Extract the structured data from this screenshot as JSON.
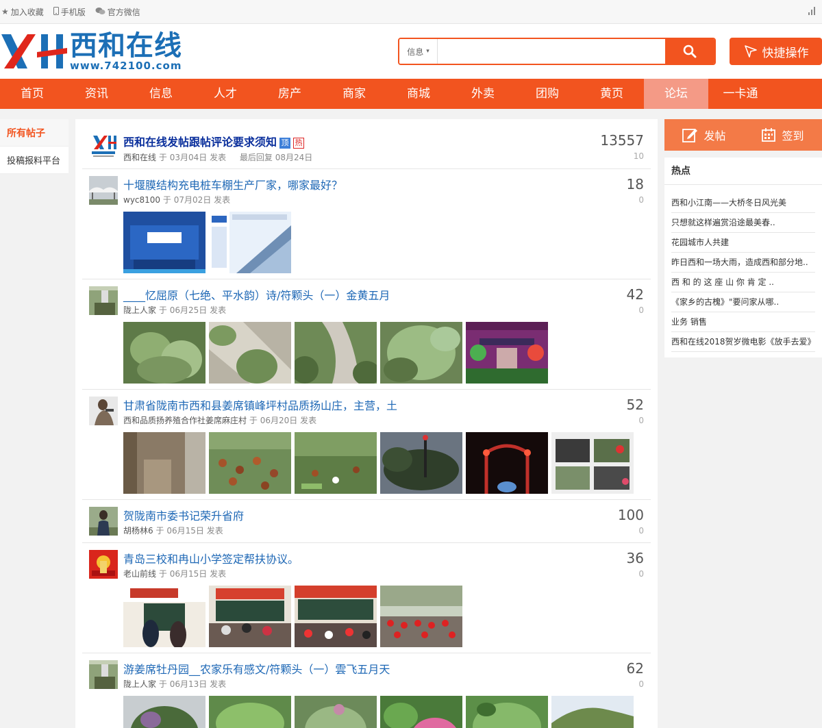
{
  "topbar": {
    "favorite": "加入收藏",
    "mobile": "手机版",
    "wechat": "官方微信"
  },
  "header": {
    "logo_mark": "XH",
    "logo_title": "西和在线",
    "logo_url": "www.742100.com",
    "search_select": "信息",
    "search_placeholder": "",
    "quick_action": "快捷操作"
  },
  "nav": [
    "首页",
    "资讯",
    "信息",
    "人才",
    "房产",
    "商家",
    "商城",
    "外卖",
    "团购",
    "黄页",
    "论坛",
    "一卡通"
  ],
  "nav_active_index": 10,
  "left_sidebar": [
    "所有帖子",
    "投稿报料平台"
  ],
  "posts": [
    {
      "title": "西和在线发帖跟帖评论要求须知",
      "pinned": true,
      "tag_top": "顶",
      "tag_hot": "热",
      "author": "西和在线",
      "yu": "于",
      "date": "03月04日",
      "fabiao": "发表",
      "last_reply_label": "最后回复",
      "last_reply": "08月24日",
      "count": "13557",
      "sub": "10",
      "images": 0
    },
    {
      "title": "十堰膜结构充电桩车棚生产厂家，哪家最好？",
      "author": "wyc8100",
      "yu": "于",
      "date": "07月02日",
      "fabiao": "发表",
      "count": "18",
      "sub": "0",
      "images": 2
    },
    {
      "title": "____忆屈原（七绝、平水韵）诗/符颗头（一）金黄五月",
      "author": "陇上人家",
      "yu": "于",
      "date": "06月25日",
      "fabiao": "发表",
      "count": "42",
      "sub": "0",
      "images": 5
    },
    {
      "title": "甘肃省陇南市西和县姜席镇峰坪村品质扬山庄，主营，土",
      "author": "西和品质扬养殖合作社姜席麻庄村",
      "yu": "于",
      "date": "06月20日",
      "fabiao": "发表",
      "count": "52",
      "sub": "0",
      "images": 6
    },
    {
      "title": "贺陇南市委书记荣升省府",
      "author": "胡杨林6",
      "yu": "于",
      "date": "06月15日",
      "fabiao": "发表",
      "count": "100",
      "sub": "0",
      "images": 0
    },
    {
      "title": "青岛三校和冉山小学签定帮扶协议。",
      "author": "老山前线",
      "yu": "于",
      "date": "06月15日",
      "fabiao": "发表",
      "count": "36",
      "sub": "0",
      "images": 4
    },
    {
      "title": "游姜席牡丹园__农家乐有感文/符颗头（一）雲飞五月天",
      "author": "陇上人家",
      "yu": "于",
      "date": "06月13日",
      "fabiao": "发表",
      "count": "62",
      "sub": "0",
      "images": 6
    }
  ],
  "right_sidebar": {
    "post_btn": "发帖",
    "signin_btn": "签到",
    "hot_title": "热点",
    "hot_items": [
      "西和小江南——大桥冬日风光美",
      "只想就这样遍赏沿途最美春..",
      "花园城市人共建",
      "昨日西和一场大雨，造成西和部分地..",
      "西 和 的 这 座 山 你 肯 定 ..",
      "《家乡的古槐》\"要问家从哪..",
      "业务 销售",
      "西和在线2018贺岁微电影《放手去爱》"
    ]
  },
  "colors": {
    "brand": "#f2541f",
    "nav_active": "#f49a86",
    "link": "#1d67b5",
    "logo": "#1c6fb6"
  }
}
